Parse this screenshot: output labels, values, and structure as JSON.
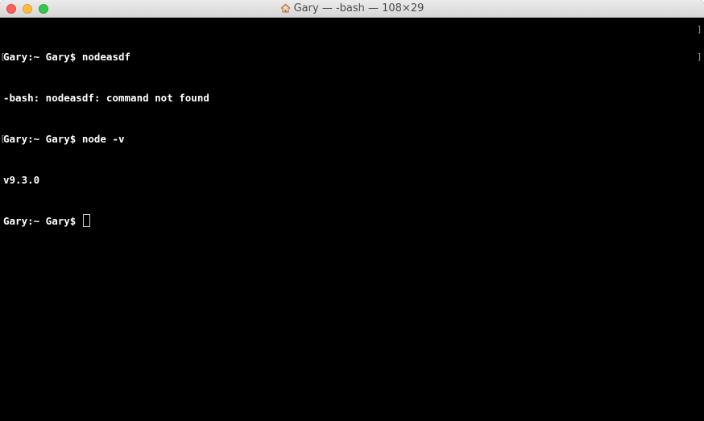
{
  "window": {
    "title": "Gary — -bash — 108×29",
    "title_icon": "home-icon"
  },
  "terminal": {
    "lines": [
      "Gary:~ Gary$ nodeasdf",
      "-bash: nodeasdf: command not found",
      "Gary:~ Gary$ node -v",
      "v9.3.0",
      "Gary:~ Gary$ "
    ],
    "marked_lines": [
      0,
      2
    ],
    "cursor": "block"
  },
  "colors": {
    "background": "#000000",
    "text": "#ffffff",
    "close": "#fc605c",
    "minimize": "#fdbc40",
    "zoom": "#34c84a"
  }
}
